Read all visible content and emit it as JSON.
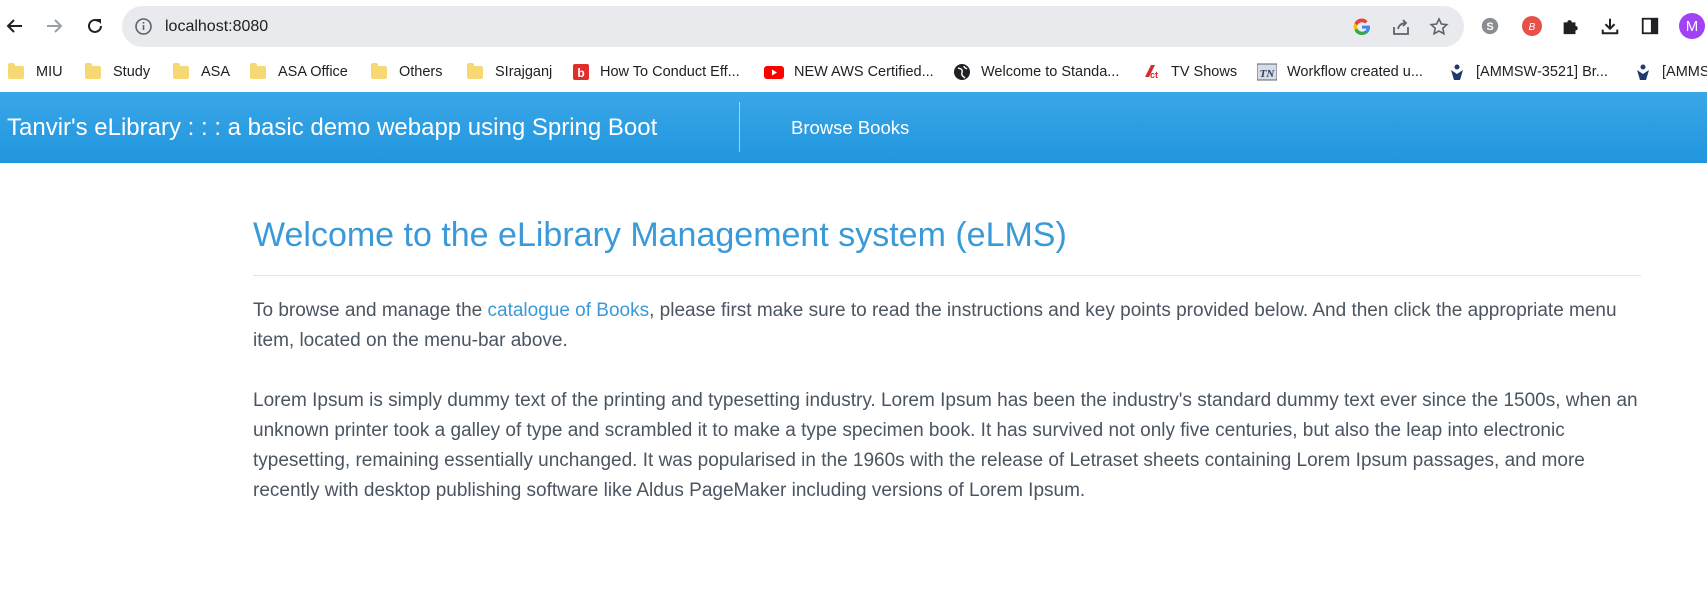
{
  "browser": {
    "url": "localhost:8080",
    "profile_initial": "M",
    "profile_color": "#a142f4"
  },
  "bookmarks": [
    {
      "label": "MIU",
      "icon": "folder-icon"
    },
    {
      "label": "Study",
      "icon": "folder-icon"
    },
    {
      "label": "ASA",
      "icon": "folder-icon"
    },
    {
      "label": "ASA Office",
      "icon": "folder-icon"
    },
    {
      "label": "Others",
      "icon": "folder-icon"
    },
    {
      "label": "SIrajganj",
      "icon": "folder-icon"
    },
    {
      "label": "How To Conduct Eff...",
      "icon": "bitly-icon"
    },
    {
      "label": "NEW AWS Certified...",
      "icon": "youtube-icon"
    },
    {
      "label": "Welcome to Standa...",
      "icon": "globe-icon"
    },
    {
      "label": "TV Shows",
      "icon": "tv-shows-icon"
    },
    {
      "label": "Workflow created u...",
      "icon": "tn-icon"
    },
    {
      "label": "[AMMSW-3521] Br...",
      "icon": "jira-icon"
    },
    {
      "label": "[AMMS",
      "icon": "jira-icon"
    }
  ],
  "navbar": {
    "brand": "Tanvir's eLibrary : : : a basic demo webapp using Spring Boot",
    "link": "Browse Books",
    "color": "#2b9de3"
  },
  "main": {
    "title": "Welcome to the eLibrary Management system (eLMS)",
    "intro_before": "To browse and manage the ",
    "intro_link": "catalogue of Books",
    "intro_after": ", please first make sure to read the instructions and key points provided below. And then click the appropriate menu item, located on the menu-bar above.",
    "lorem": "Lorem Ipsum is simply dummy text of the printing and typesetting industry. Lorem Ipsum has been the industry's standard dummy text ever since the 1500s, when an unknown printer took a galley of type and scrambled it to make a type specimen book. It has survived not only five centuries, but also the leap into electronic typesetting, remaining essentially unchanged. It was popularised in the 1960s with the release of Letraset sheets containing Lorem Ipsum passages, and more recently with desktop publishing software like Aldus PageMaker including versions of Lorem Ipsum."
  }
}
